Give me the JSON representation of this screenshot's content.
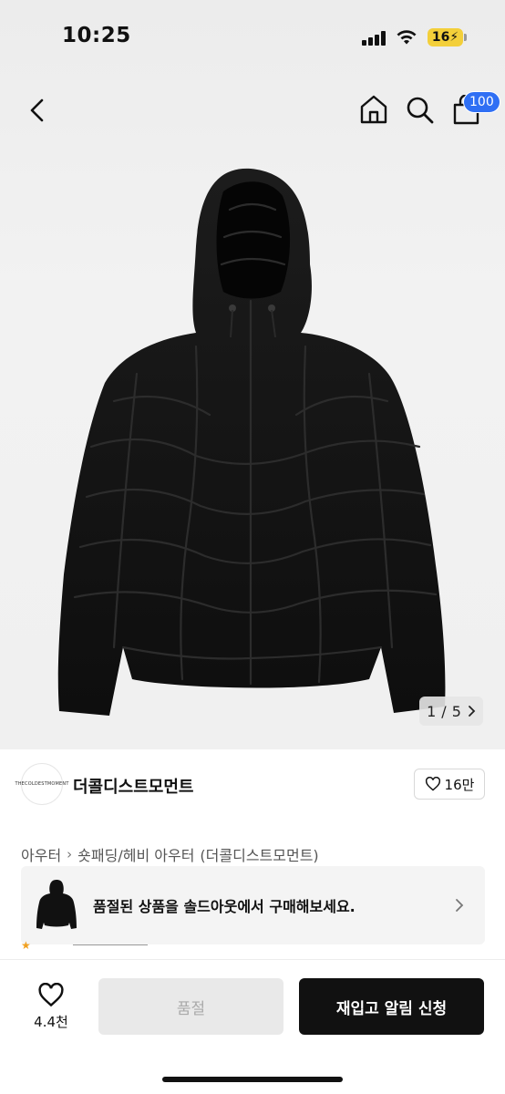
{
  "status_bar": {
    "time": "10:25",
    "battery": "16⚡"
  },
  "nav": {
    "back_icon": "chevron-left-icon",
    "home_icon": "home-icon",
    "search_icon": "search-icon",
    "cart_icon": "cart-icon",
    "cart_count": "100"
  },
  "gallery": {
    "counter_current": "1",
    "counter_sep": "/",
    "counter_total": "5"
  },
  "brand": {
    "logo_text": "THECOLDESTMOMENT",
    "name": "더콜디스트모먼트",
    "likes": "16만"
  },
  "breadcrumb": {
    "items": [
      "아우터",
      "숏패딩/헤비 아우터",
      "(더콜디스트모먼트)"
    ]
  },
  "soldout_banner": {
    "message": "품절된 상품을 솔드아웃에서 구매해보세요."
  },
  "bottom_bar": {
    "wish_count": "4.4천",
    "soldout_label": "품절",
    "restock_label": "재입고 알림 신청"
  },
  "colors": {
    "accent": "#2f6ff4",
    "primary_button": "#111111",
    "disabled_button": "#e9e9e9"
  }
}
